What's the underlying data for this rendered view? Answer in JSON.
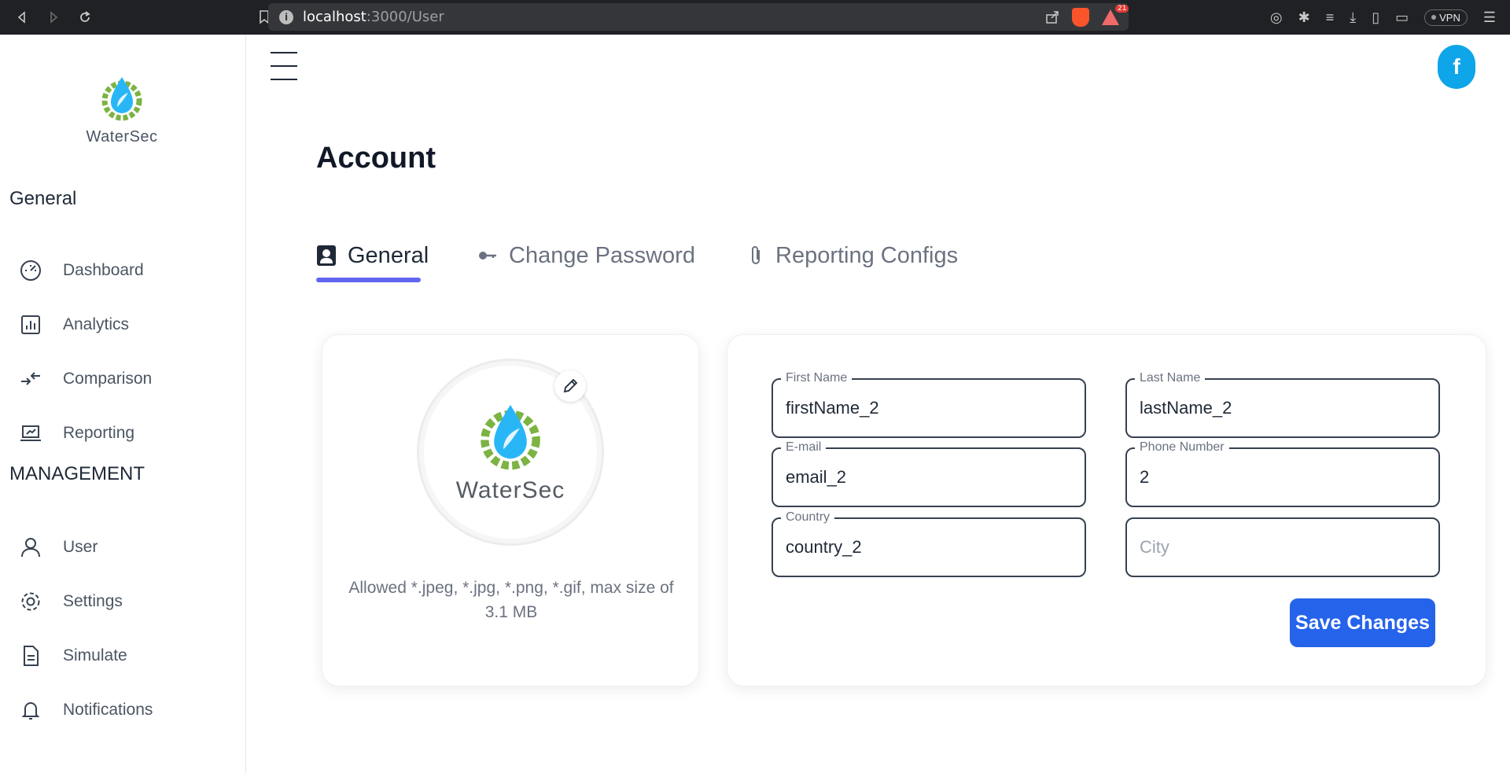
{
  "browser": {
    "url_host": "localhost",
    "url_path": ":3000/User",
    "info_glyph": "i",
    "alert_count": "21",
    "vpn_label": "VPN"
  },
  "app": {
    "logo_name": "WaterSec",
    "fb_letter": "f"
  },
  "sidebar": {
    "general_title": "General",
    "general_items": [
      {
        "label": "Dashboard",
        "icon": "gauge-icon"
      },
      {
        "label": "Analytics",
        "icon": "bar-chart-icon"
      },
      {
        "label": "Comparison",
        "icon": "compare-arrows-icon"
      },
      {
        "label": "Reporting",
        "icon": "laptop-report-icon"
      }
    ],
    "management_title": "MANAGEMENT",
    "management_items": [
      {
        "label": "User",
        "icon": "user-icon"
      },
      {
        "label": "Settings",
        "icon": "gear-icon"
      },
      {
        "label": "Simulate",
        "icon": "document-icon"
      },
      {
        "label": "Notifications",
        "icon": "bell-icon"
      }
    ]
  },
  "main": {
    "title": "Account",
    "tabs": [
      {
        "label": "General",
        "active": true
      },
      {
        "label": "Change Password",
        "active": false
      },
      {
        "label": "Reporting Configs",
        "active": false
      }
    ],
    "avatar": {
      "name": "WaterSec",
      "allowed_text": "Allowed *.jpeg, *.jpg, *.png, *.gif, max size of 3.1 MB"
    },
    "form": {
      "first_name": {
        "label": "First Name",
        "value": "firstName_2"
      },
      "last_name": {
        "label": "Last Name",
        "value": "lastName_2"
      },
      "email": {
        "label": "E-mail",
        "value": "email_2"
      },
      "phone": {
        "label": "Phone Number",
        "value": "2"
      },
      "country": {
        "label": "Country",
        "value": "country_2"
      },
      "city": {
        "placeholder": "City",
        "value": ""
      },
      "save_label": "Save Changes"
    }
  },
  "colors": {
    "accent": "#6366f1",
    "primary_button": "#2563eb",
    "fb_button": "#0ea5e9"
  }
}
